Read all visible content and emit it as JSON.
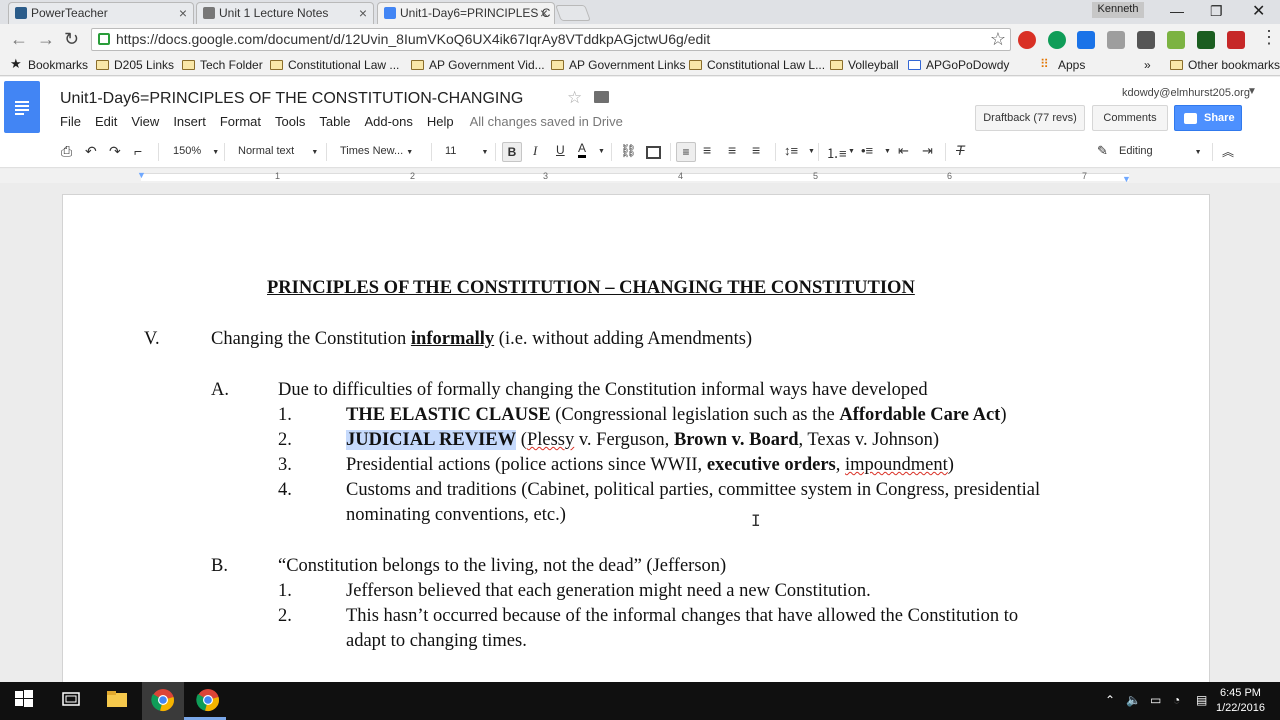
{
  "browser": {
    "tabs": [
      {
        "label": "PowerTeacher",
        "active": false
      },
      {
        "label": "Unit 1 Lecture Notes",
        "active": false
      },
      {
        "label": "Unit1-Day6=PRINCIPLES C",
        "active": true
      }
    ],
    "user_badge": "Kenneth",
    "url": "https://docs.google.com/document/d/12Uvin_8IumVKoQ6UX4ik67IqrAy8VTddkpAGjctwU6g/edit",
    "bookmarks": [
      "Bookmarks",
      "D205 Links",
      "Tech Folder",
      "Constitutional Law ...",
      "AP Government Vid...",
      "AP Government Links",
      "Constitutional Law L...",
      "Volleyball",
      "APGoPoDowdy",
      "Apps",
      "Other bookmarks"
    ],
    "bookmarks_overflow": "»"
  },
  "docs": {
    "title": "Unit1-Day6=PRINCIPLES OF THE CONSTITUTION-CHANGING",
    "menu": [
      "File",
      "Edit",
      "View",
      "Insert",
      "Format",
      "Tools",
      "Table",
      "Add-ons",
      "Help"
    ],
    "save_status": "All changes saved in Drive",
    "account": "kdowdy@elmhurst205.org",
    "draftback_label": "Draftback (77 revs)",
    "comments_label": "Comments",
    "share_label": "Share"
  },
  "toolbar": {
    "zoom": "150%",
    "style": "Normal text",
    "font": "Times New...",
    "size": "11",
    "mode": "Editing",
    "bold_active": true
  },
  "ruler": {
    "numbers": [
      "1",
      "2",
      "3",
      "4",
      "5",
      "6",
      "7"
    ]
  },
  "document": {
    "heading": "PRINCIPLES OF THE CONSTITUTION – CHANGING THE CONSTITUTION",
    "v_num": "V.",
    "v_pre": "Changing the Constitution ",
    "v_emph": "informally",
    "v_post": " (i.e. without adding Amendments)",
    "a_num": "A.",
    "a_text": "Due to difficulties of formally changing the Constitution informal ways have developed",
    "a1_num": "1.",
    "a1_b1": "THE ELASTIC CLAUSE",
    "a1_t1": " (Congressional legislation such as the ",
    "a1_b2": "Affordable Care Act",
    "a1_t2": ")",
    "a2_num": "2.",
    "a2_b1": "JUDICIAL REVIEW",
    "a2_t1": " (",
    "a2_sq": "Plessy",
    "a2_t2": " v. Ferguson, ",
    "a2_b2": "Brown v. Board",
    "a2_t3": ", Texas v. Johnson)",
    "a3_num": "3.",
    "a3_t1": "Presidential actions (police actions since WWII, ",
    "a3_b1": "executive orders",
    "a3_t2": ", ",
    "a3_sq": "impoundment",
    "a3_t3": ")",
    "a4_num": "4.",
    "a4_line1": "Customs and traditions (Cabinet, political parties, committee system in Congress, presidential",
    "a4_line2": "nominating conventions, etc.)",
    "b_num": "B.",
    "b_text": "“Constitution belongs to the living, not the dead” (Jefferson)",
    "b1_num": "1.",
    "b1_text": "Jefferson believed that each generation might need a new Constitution.",
    "b2_num": "2.",
    "b2_line1": "This hasn’t occurred because of the informal changes that have allowed the Constitution to",
    "b2_line2": "adapt to changing times."
  },
  "taskbar": {
    "time": "6:45 PM",
    "date": "1/22/2016"
  },
  "colors": {
    "docs_blue": "#4285f4",
    "share_blue": "#4d90fe",
    "selection": "#c6dafc",
    "squiggle": "#d93025"
  }
}
